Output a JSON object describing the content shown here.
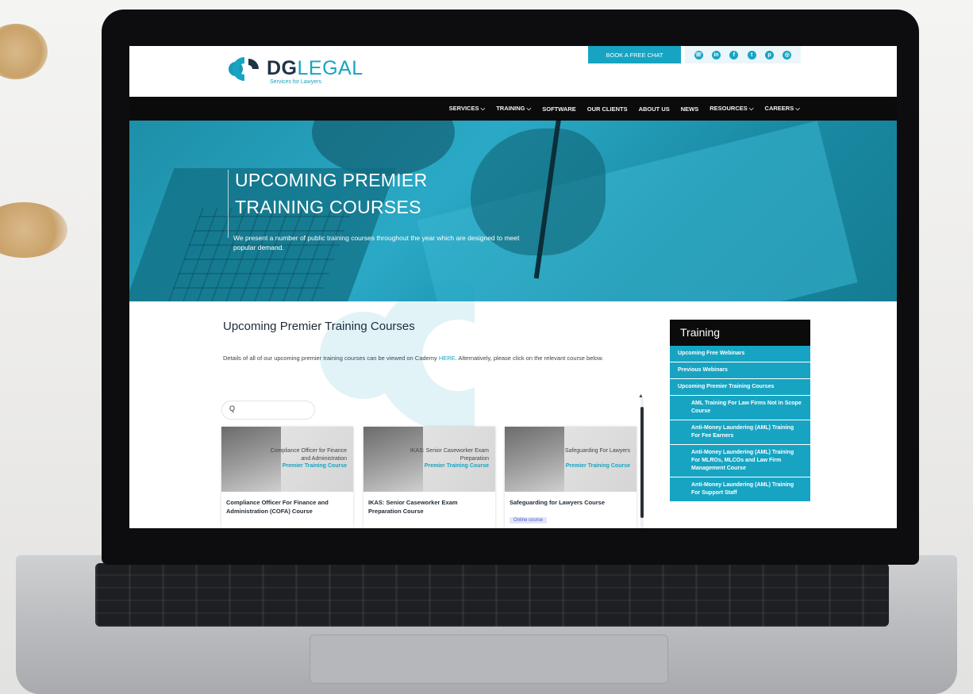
{
  "header": {
    "logo_primary": "DG",
    "logo_secondary": "LEGAL",
    "logo_tagline": "Services for Lawyers",
    "book_button": "BOOK A FREE CHAT",
    "social_icons": [
      "phone-icon",
      "linkedin-icon",
      "facebook-icon",
      "twitter-icon",
      "pinterest-icon",
      "instagram-icon"
    ],
    "nav": [
      "SERVICES ⌵",
      "TRAINING ⌵",
      "SOFTWARE",
      "OUR CLIENTS",
      "ABOUT US",
      "NEWS",
      "RESOURCES ⌵",
      "CAREERS ⌵"
    ]
  },
  "hero": {
    "title_line1": "UPCOMING PREMIER",
    "title_line2": "TRAINING COURSES",
    "description": "We present a number of public training courses throughout the year which are designed to meet popular demand."
  },
  "main": {
    "title": "Upcoming Premier Training Courses",
    "text_before": "Details of all of our upcoming premier training courses can be viewed on Cademy ",
    "link": "HERE",
    "text_after": ". Alternatively, please click on the relevant course below.",
    "search_icon": "Q",
    "cards": [
      {
        "image_title": "Compliance Officer for Finance and Administration",
        "image_subtitle": "Premier Training Course",
        "title": "Compliance Officer For Finance and Administration (COFA) Course",
        "tag": ""
      },
      {
        "image_title": "IKAS: Senior Caseworker Exam Preparation",
        "image_subtitle": "Premier Training Course",
        "title": "IKAS: Senior Caseworker Exam Preparation Course",
        "tag": ""
      },
      {
        "image_title": "Safeguarding For Lawyers",
        "image_subtitle": "Premier Training Course",
        "title": "Safeguarding for Lawyers Course",
        "tag": "Online course"
      }
    ]
  },
  "sidebar": {
    "title": "Training",
    "items": [
      {
        "label": "Upcoming Free Webinars",
        "sub": false
      },
      {
        "label": "Previous Webinars",
        "sub": false
      },
      {
        "label": "Upcoming Premier Training Courses",
        "sub": false
      },
      {
        "label": "AML Training For Law Firms Not In Scope Course",
        "sub": true
      },
      {
        "label": "Anti-Money Laundering (AML) Training For Fee Earners",
        "sub": true
      },
      {
        "label": "Anti-Money Laundering (AML) Training For MLROs, MLCOs and Law Firm Management Course",
        "sub": true
      },
      {
        "label": "Anti-Money Laundering (AML) Training For Support Staff",
        "sub": true
      }
    ]
  },
  "colors": {
    "brand_teal": "#17a4c2",
    "nav_black": "#0b0b0c",
    "brand_navy": "#1f3346"
  }
}
